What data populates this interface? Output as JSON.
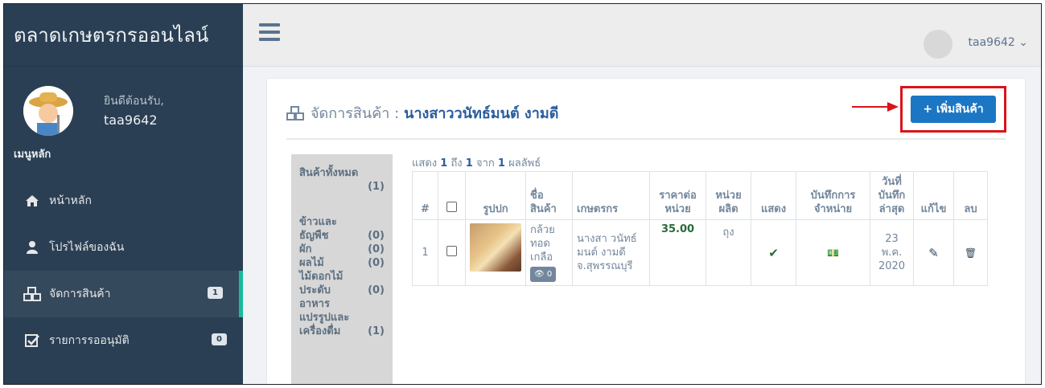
{
  "sidebar": {
    "brand": "ตลาดเกษตรกรออนไลน์",
    "welcome": "ยินดีต้อนรับ,",
    "username": "taa9642",
    "menu_header": "เมนูหลัก",
    "items": [
      {
        "label": "หน้าหลัก",
        "icon": "home-icon"
      },
      {
        "label": "โปรไฟล์ของฉัน",
        "icon": "user-icon"
      },
      {
        "label": "จัดการสินค้า",
        "icon": "cubes-icon",
        "badge": "1",
        "active": true
      },
      {
        "label": "รายการรออนุมัติ",
        "icon": "check-square-icon",
        "badge": "0"
      }
    ]
  },
  "topbar": {
    "username": "taa9642 ⌄"
  },
  "panel": {
    "title_prefix": "จัดการสินค้า :",
    "title_who": "นางสาววนัทธ์มนต์ งามดี",
    "add_button": "+ เพิ่มสินค้า"
  },
  "categories": {
    "all_label": "สินค้าทั้งหมด",
    "all_count": "(1)",
    "rows": [
      {
        "label": "ข้าวและ",
        "count": ""
      },
      {
        "label": "ธัญพืช",
        "count": "(0)"
      },
      {
        "label": "ผัก",
        "count": "(0)"
      },
      {
        "label": "ผลไม้",
        "count": "(0)"
      },
      {
        "label": "ไม้ดอกไม้",
        "count": ""
      },
      {
        "label": "ประดับ",
        "count": "(0)"
      },
      {
        "label": "อาหาร",
        "count": ""
      },
      {
        "label": "แปรรูปและ",
        "count": ""
      },
      {
        "label": "เครื่องดื่ม",
        "count": "(1)"
      }
    ]
  },
  "showing": {
    "prefix": "แสดง",
    "from": "1",
    "mid1": "ถึง",
    "to": "1",
    "mid2": "จาก",
    "total": "1",
    "suffix": "ผลลัพธ์"
  },
  "table": {
    "headers": {
      "num": "#",
      "image": "รูปปก",
      "name": "ชื่อ สินค้า",
      "farmer": "เกษตรกร",
      "price": "ราคาต่อ หน่วย",
      "unit": "หน่วย ผลิต",
      "show": "แสดง",
      "sales": "บันทึกการ จำหน่าย",
      "date": "วันที่ บันทึก ล่าสุด",
      "edit": "แก้ไข",
      "delete": "ลบ"
    },
    "row": {
      "num": "1",
      "name": "กล้วย ทอด เกลือ",
      "views": "👁 0",
      "farmer": "นางสา วนัทธ์มนต์ งามดี",
      "province": "จ.สุพรรณบุรี",
      "price": "35.00",
      "unit": "ถุง",
      "show": "✔",
      "sales": "💵",
      "date_day": "23",
      "date_month": "พ.ค.",
      "date_year": "2020",
      "edit": "✎",
      "delete": "🗑"
    }
  }
}
